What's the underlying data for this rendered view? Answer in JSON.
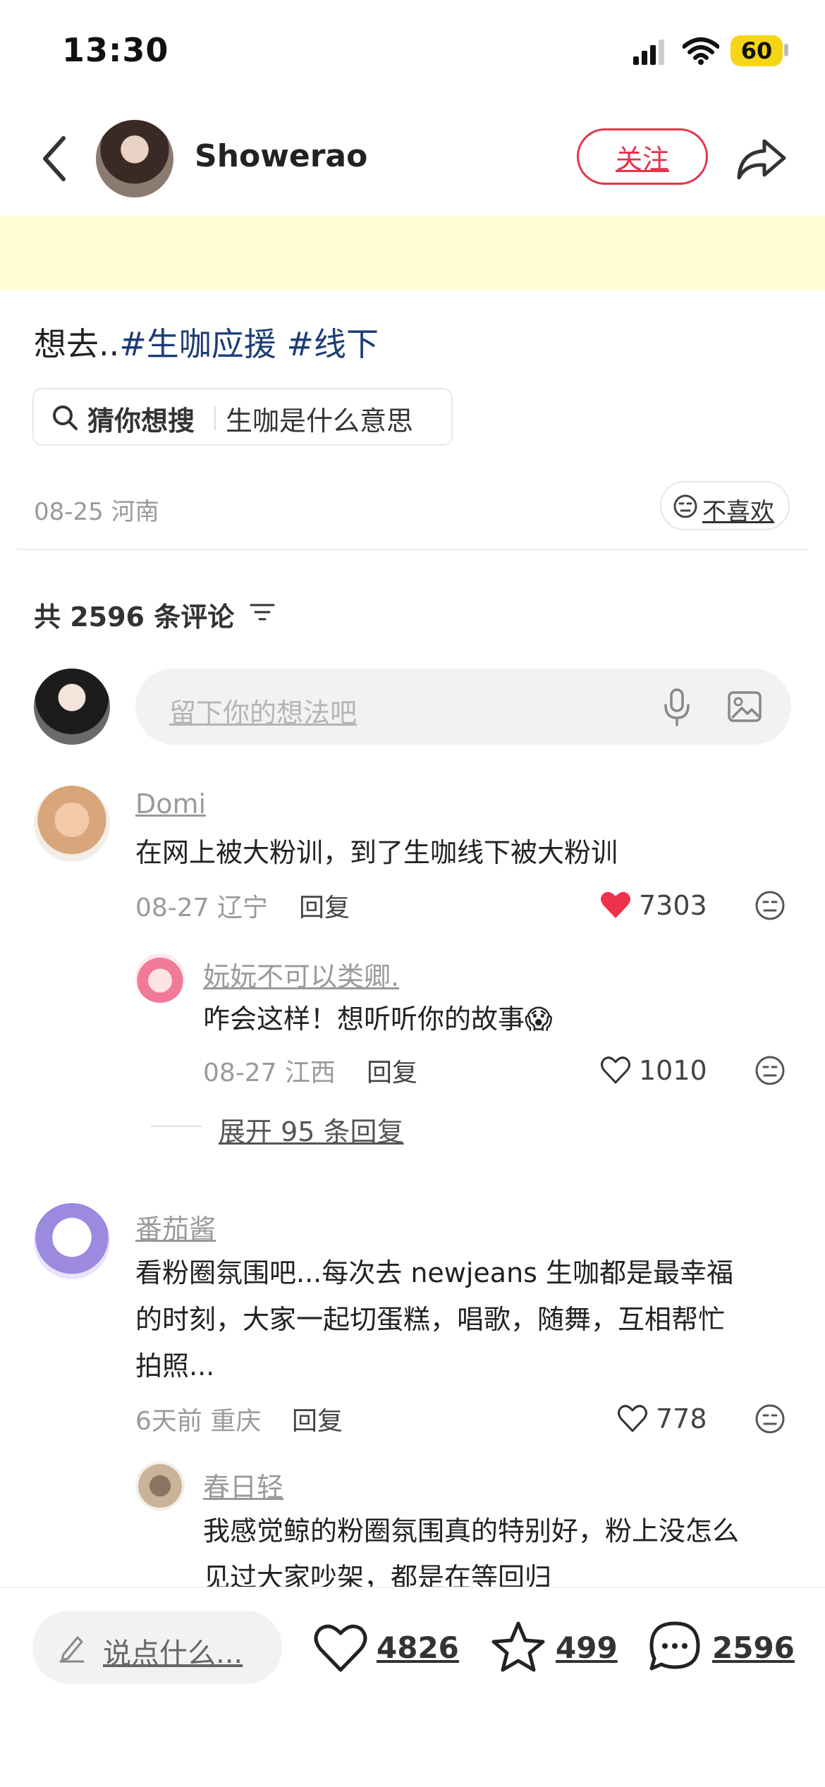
{
  "status": {
    "time": "13:30",
    "battery": "60"
  },
  "header": {
    "author_name": "Showerao",
    "follow_label": "关注"
  },
  "post": {
    "title_prefix": "想去..",
    "tags": [
      "#生咖应援",
      "#线下"
    ],
    "search_label": "猜你想搜",
    "search_query": "生咖是什么意思",
    "date_location": "08-25 河南",
    "dislike_label": "不喜欢"
  },
  "comments_section": {
    "count_label": "共 2596 条评论",
    "input_placeholder": "留下你的想法吧"
  },
  "comments": [
    {
      "name": "Domi",
      "text": "在网上被大粉训，到了生咖线下被大粉训",
      "meta": "08-27 辽宁",
      "reply": "回复",
      "likes": "7303",
      "liked": true,
      "replies": [
        {
          "name": "妧妧不可以类卿.",
          "text": "咋会这样！想听听你的故事",
          "emoji": "😱",
          "meta": "08-27 江西",
          "reply": "回复",
          "likes": "1010"
        }
      ],
      "expand_label": "展开 95 条回复"
    },
    {
      "name": "番茄酱",
      "text_lines": [
        "看粉圈氛围吧...每次去 newjeans 生咖都是最幸福",
        "的时刻，大家一起切蛋糕，唱歌，随舞，互相帮忙",
        "拍照..."
      ],
      "meta": "6天前 重庆",
      "reply": "回复",
      "likes": "778",
      "replies": [
        {
          "name": "春日轻",
          "text_lines": [
            "我感觉鲸的粉圈氛围真的特别好，粉上没怎么",
            "见过大家吵架，都是在等回归"
          ]
        }
      ]
    }
  ],
  "bottom_bar": {
    "say_label": "说点什么...",
    "likes": "4826",
    "stars": "499",
    "comments": "2596"
  },
  "colors": {
    "accent": "#e5334b",
    "tag": "#1d3d76",
    "banner": "#fefcd4",
    "battery": "#f5d515"
  }
}
